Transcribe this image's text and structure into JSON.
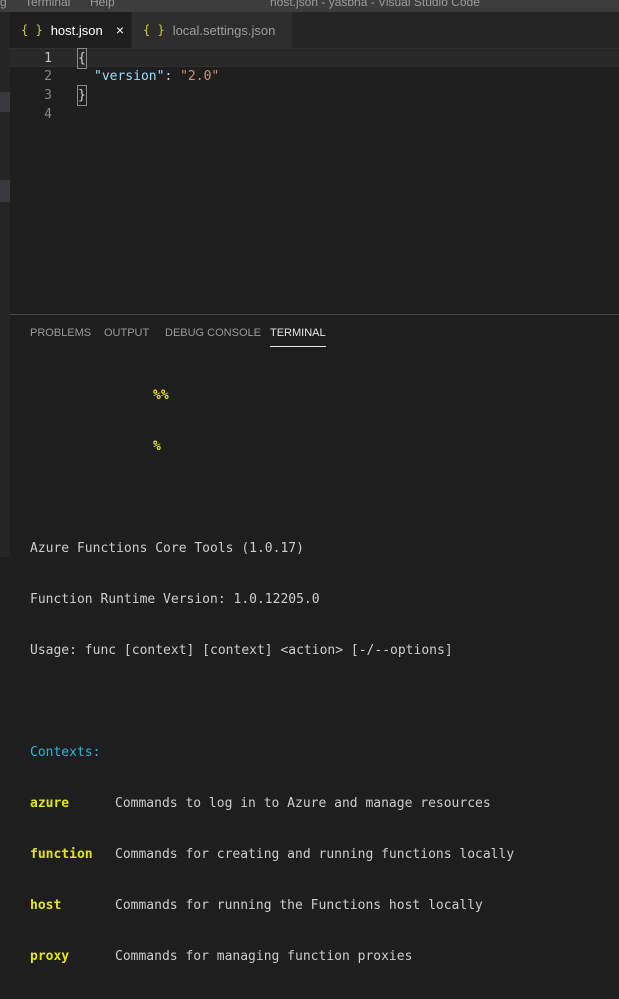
{
  "titlebar": {
    "menu_items": [
      "g",
      "Terminal",
      "Help"
    ],
    "window_title": "host.json - yasbha - Visual Studio Code"
  },
  "tabs": [
    {
      "icon": "{ }",
      "label": "host.json",
      "close": "×",
      "active": true
    },
    {
      "icon": "{ }",
      "label": "local.settings.json",
      "active": false
    }
  ],
  "editor": {
    "lines": [
      {
        "num": "1",
        "text": "{"
      },
      {
        "num": "2",
        "key": "\"version\"",
        "sep": ": ",
        "value": "\"2.0\""
      },
      {
        "num": "3",
        "text": "}"
      },
      {
        "num": "4",
        "text": ""
      }
    ]
  },
  "panel": {
    "tabs": [
      "PROBLEMS",
      "OUTPUT",
      "DEBUG CONSOLE",
      "TERMINAL"
    ],
    "active_tab": "TERMINAL"
  },
  "terminal": {
    "art1": "%%",
    "art2": "%",
    "core_tools": "Azure Functions Core Tools (1.0.17)",
    "runtime": "Function Runtime Version: 1.0.12205.0",
    "usage": "Usage: func [context] [context] <action> [-/--options]",
    "contexts_label": "Contexts:",
    "contexts": [
      {
        "name": "azure",
        "desc": "Commands to log in to Azure and manage resources"
      },
      {
        "name": "function",
        "desc": "Commands for creating and running functions locally"
      },
      {
        "name": "host",
        "desc": "Commands for running the Functions host locally"
      },
      {
        "name": "proxy",
        "desc": "Commands for managing function proxies"
      }
    ]
  },
  "colors": {
    "editor_bg": "#1e1e1e",
    "json_key": "#9cdcfe",
    "json_string": "#ce9178",
    "terminal_yellow": "#e5e510",
    "terminal_cyan": "#29b8db"
  }
}
